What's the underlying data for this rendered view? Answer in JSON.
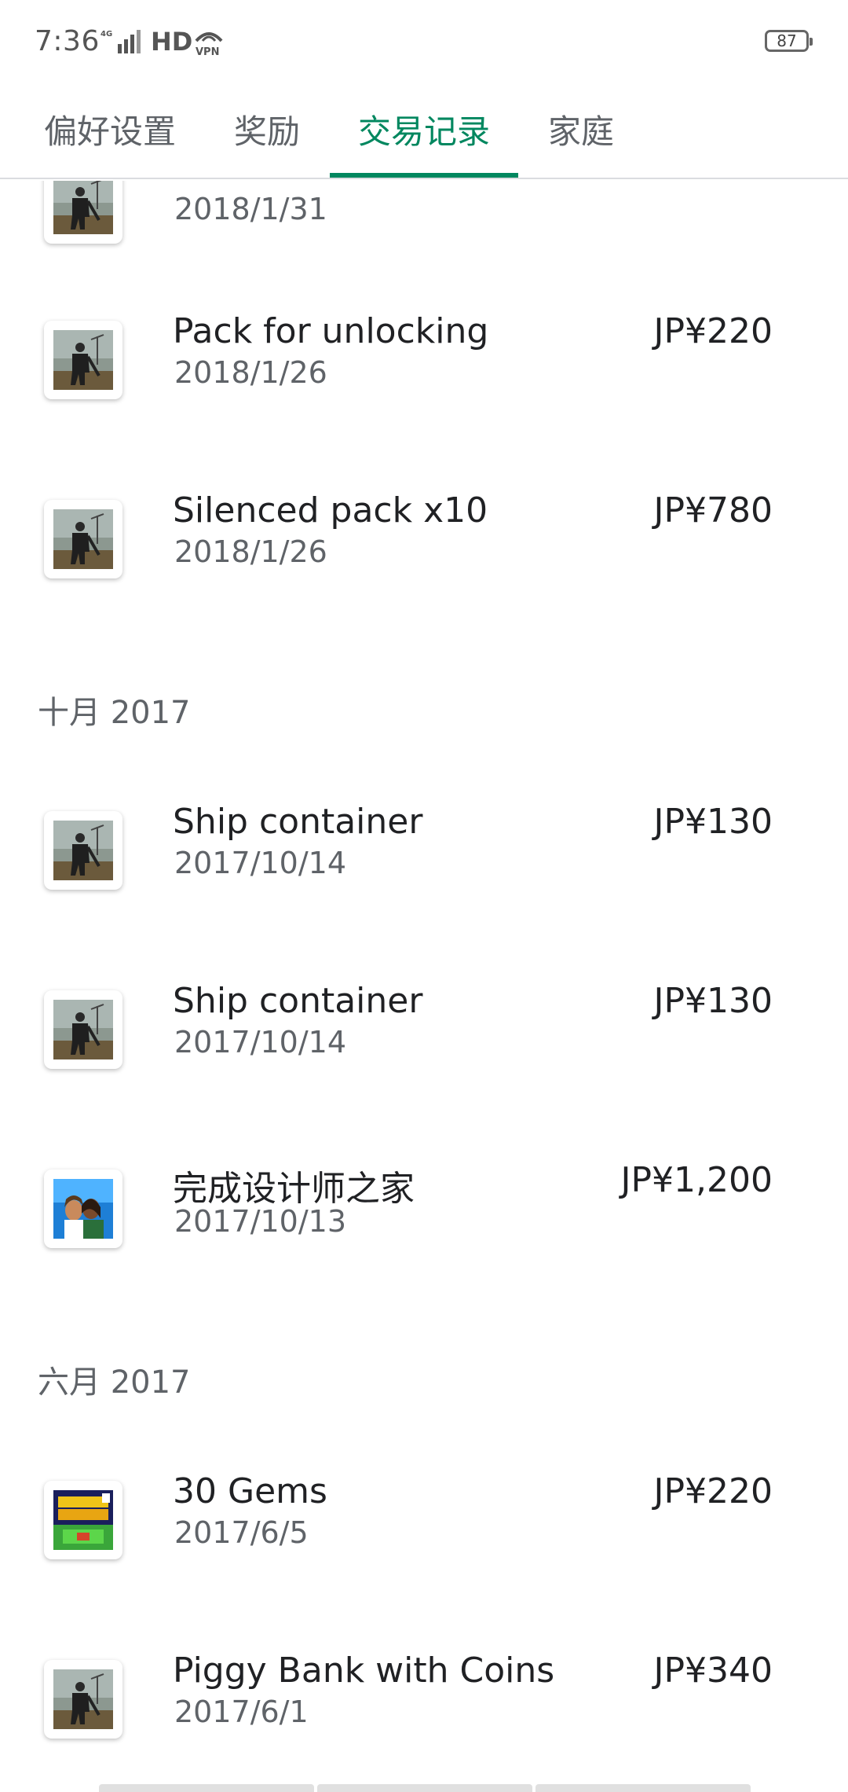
{
  "status_bar": {
    "time": "7:36",
    "network": "4G",
    "hd": "HD",
    "vpn": "VPN",
    "battery": "87"
  },
  "tabs": [
    {
      "label": "偏好设置",
      "active": false
    },
    {
      "label": "奖励",
      "active": false
    },
    {
      "label": "交易记录",
      "active": true
    },
    {
      "label": "家庭",
      "active": false
    }
  ],
  "accent_color": "#01875f",
  "partial_row": {
    "date": "2018/1/31",
    "icon": "last-day-game-icon"
  },
  "rows": [
    {
      "title": "Pack for unlocking",
      "date": "2018/1/26",
      "price": "JP¥220",
      "icon": "last-day-game-icon"
    },
    {
      "title": "Silenced pack x10",
      "date": "2018/1/26",
      "price": "JP¥780",
      "icon": "last-day-game-icon"
    }
  ],
  "sections": [
    {
      "header": "十月 2017",
      "rows": [
        {
          "title": "Ship container",
          "date": "2017/10/14",
          "price": "JP¥130",
          "icon": "last-day-game-icon"
        },
        {
          "title": "Ship container",
          "date": "2017/10/14",
          "price": "JP¥130",
          "icon": "last-day-game-icon"
        },
        {
          "title": "完成设计师之家",
          "date": "2017/10/13",
          "price": "JP¥1,200",
          "icon": "sims-game-icon"
        }
      ]
    },
    {
      "header": "六月 2017",
      "rows": [
        {
          "title": "30 Gems",
          "date": "2017/6/5",
          "price": "JP¥220",
          "icon": "pixel-survival-game-icon"
        },
        {
          "title": "Piggy Bank with Coins",
          "date": "2017/6/1",
          "price": "JP¥340",
          "icon": "last-day-game-icon"
        }
      ]
    }
  ]
}
